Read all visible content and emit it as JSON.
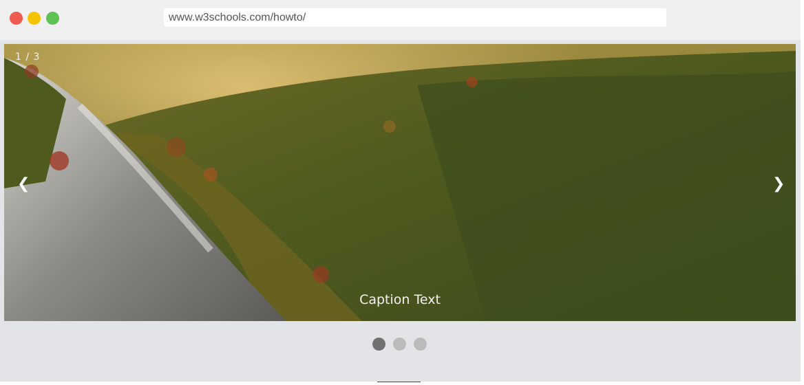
{
  "window": {
    "url": "www.w3schools.com/howto/"
  },
  "slideshow": {
    "number_text": "1 / 3",
    "caption": "Caption Text",
    "prev_label": "❮",
    "next_label": "❯",
    "current_slide": 1,
    "total_slides": 3
  },
  "colors": {
    "close": "#ef5a51",
    "minimize": "#f6c302",
    "maximize": "#5dc154",
    "dot_active": "#717171",
    "dot_inactive": "#bbbbbb"
  }
}
